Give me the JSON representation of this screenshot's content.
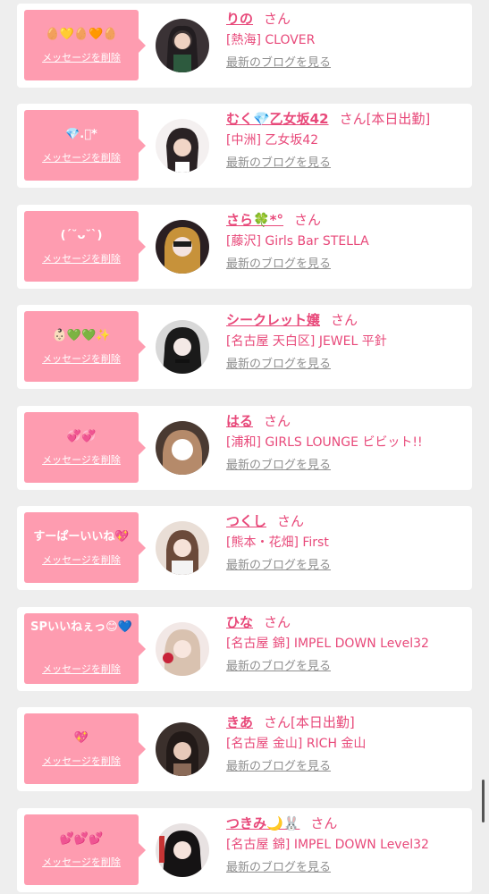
{
  "delete_label": "メッセージを削除",
  "blog_label": "最新のブログを見る",
  "honorific": "さん",
  "colors": {
    "bubble": "#fe9cb0",
    "accent": "#e8497a",
    "muted": "#8f8f8f"
  },
  "entries": [
    {
      "message": "🥚💛🥚🧡🥚",
      "name": "りの",
      "attendance": "",
      "shop": "[熱海] CLOVER"
    },
    {
      "message": "💎.ﾟ*",
      "name": "むく💎乙女坂42",
      "attendance": "[本日出勤]",
      "shop": "[中洲] 乙女坂42"
    },
    {
      "message": "(ˊ˘ᴗ˘ˋ)",
      "name": "さら🍀*°",
      "attendance": "",
      "shop": "[藤沢] Girls Bar STELLA"
    },
    {
      "message": "👶🏻💚💚✨",
      "name": "シークレット嬢",
      "attendance": "",
      "shop": "[名古屋 天白区] JEWEL 平針"
    },
    {
      "message": "💞💞",
      "name": "はる",
      "attendance": "",
      "shop": "[浦和] GIRLS LOUNGE ビビット!!"
    },
    {
      "message": "すーぱーいいね💖",
      "name": "つくし",
      "attendance": "",
      "shop": "[熊本・花畑] First"
    },
    {
      "message": "SPいいねぇっ😊💙",
      "name": "ひな",
      "attendance": "",
      "shop": "[名古屋 錦] IMPEL DOWN Level32"
    },
    {
      "message": "💖",
      "name": "きあ",
      "attendance": "[本日出勤]",
      "shop": "[名古屋 金山] RICH 金山"
    },
    {
      "message": "💕💕💕",
      "name": "つきみ🌙🐰",
      "attendance": "",
      "shop": "[名古屋 錦] IMPEL DOWN Level32"
    }
  ]
}
